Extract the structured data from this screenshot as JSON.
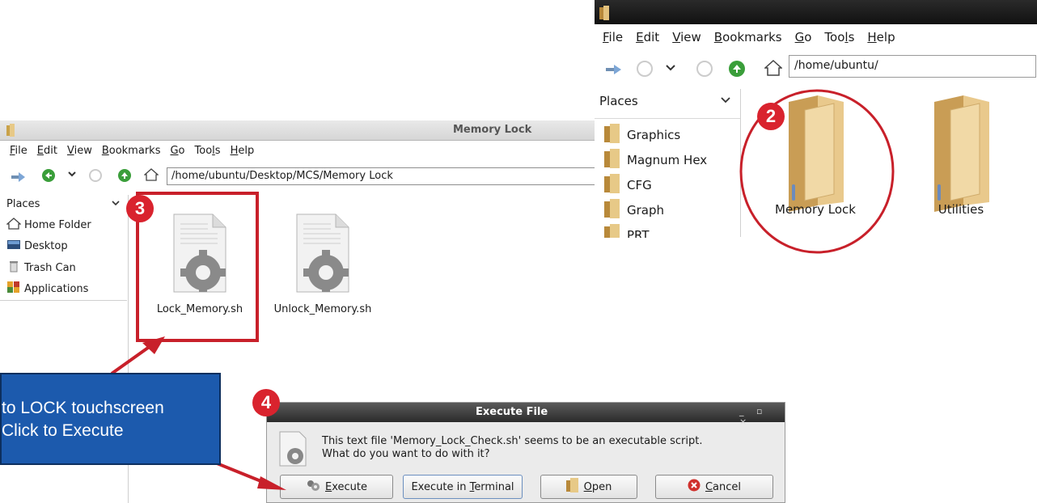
{
  "main_window": {
    "title": "Memory Lock",
    "close_glyph": "×",
    "menu": [
      {
        "pre": "",
        "u": "F",
        "post": "ile"
      },
      {
        "pre": "",
        "u": "E",
        "post": "dit"
      },
      {
        "pre": "",
        "u": "V",
        "post": "iew"
      },
      {
        "pre": "",
        "u": "B",
        "post": "ookmarks"
      },
      {
        "pre": "",
        "u": "G",
        "post": "o"
      },
      {
        "pre": "Too",
        "u": "l",
        "post": "s"
      },
      {
        "pre": "",
        "u": "H",
        "post": "elp"
      }
    ],
    "address": "/home/ubuntu/Desktop/MCS/Memory Lock",
    "sidebar": {
      "heading": "Places",
      "items": [
        {
          "label": "Home Folder",
          "icon": "home-icon"
        },
        {
          "label": "Desktop",
          "icon": "desktop-icon"
        },
        {
          "label": "Trash Can",
          "icon": "trash-icon"
        },
        {
          "label": "Applications",
          "icon": "applications-icon"
        }
      ]
    },
    "files": [
      {
        "label": "Lock_Memory.sh",
        "icon": "script-gear-icon"
      },
      {
        "label": "Unlock_Memory.sh",
        "icon": "script-gear-icon"
      }
    ]
  },
  "second_window": {
    "menu": [
      {
        "pre": "",
        "u": "F",
        "post": "ile"
      },
      {
        "pre": "",
        "u": "E",
        "post": "dit"
      },
      {
        "pre": "",
        "u": "V",
        "post": "iew"
      },
      {
        "pre": "",
        "u": "B",
        "post": "ookmarks"
      },
      {
        "pre": "",
        "u": "G",
        "post": "o"
      },
      {
        "pre": "Too",
        "u": "l",
        "post": "s"
      },
      {
        "pre": "",
        "u": "H",
        "post": "elp"
      }
    ],
    "address": "/home/ubuntu/",
    "sidebar": {
      "heading": "Places",
      "items": [
        "Graphics",
        "Magnum Hex",
        "CFG",
        "Graph",
        "PRT"
      ]
    },
    "folders": [
      "Memory Lock",
      "Utilities"
    ]
  },
  "dialog": {
    "title": "Execute File",
    "controls": "_ ▫ ×",
    "message_line1": "This text file 'Memory_Lock_Check.sh' seems to be an executable script.",
    "message_line2": "What do you want to do with it?",
    "buttons": [
      {
        "pre": "",
        "u": "E",
        "post": "xecute",
        "icon": "execute-icon"
      },
      {
        "pre": "Execute in ",
        "u": "T",
        "post": "erminal",
        "icon": ""
      },
      {
        "pre": "",
        "u": "O",
        "post": "pen",
        "icon": "folder-icon"
      },
      {
        "pre": "",
        "u": "C",
        "post": "ancel",
        "icon": "cancel-icon"
      }
    ]
  },
  "annotations": {
    "steps": [
      "2",
      "3",
      "4"
    ],
    "callout_line1": "to LOCK touchscreen",
    "callout_line2": "Click to Execute",
    "accent_color": "#d9232e",
    "callout_color": "#1c5aad"
  }
}
